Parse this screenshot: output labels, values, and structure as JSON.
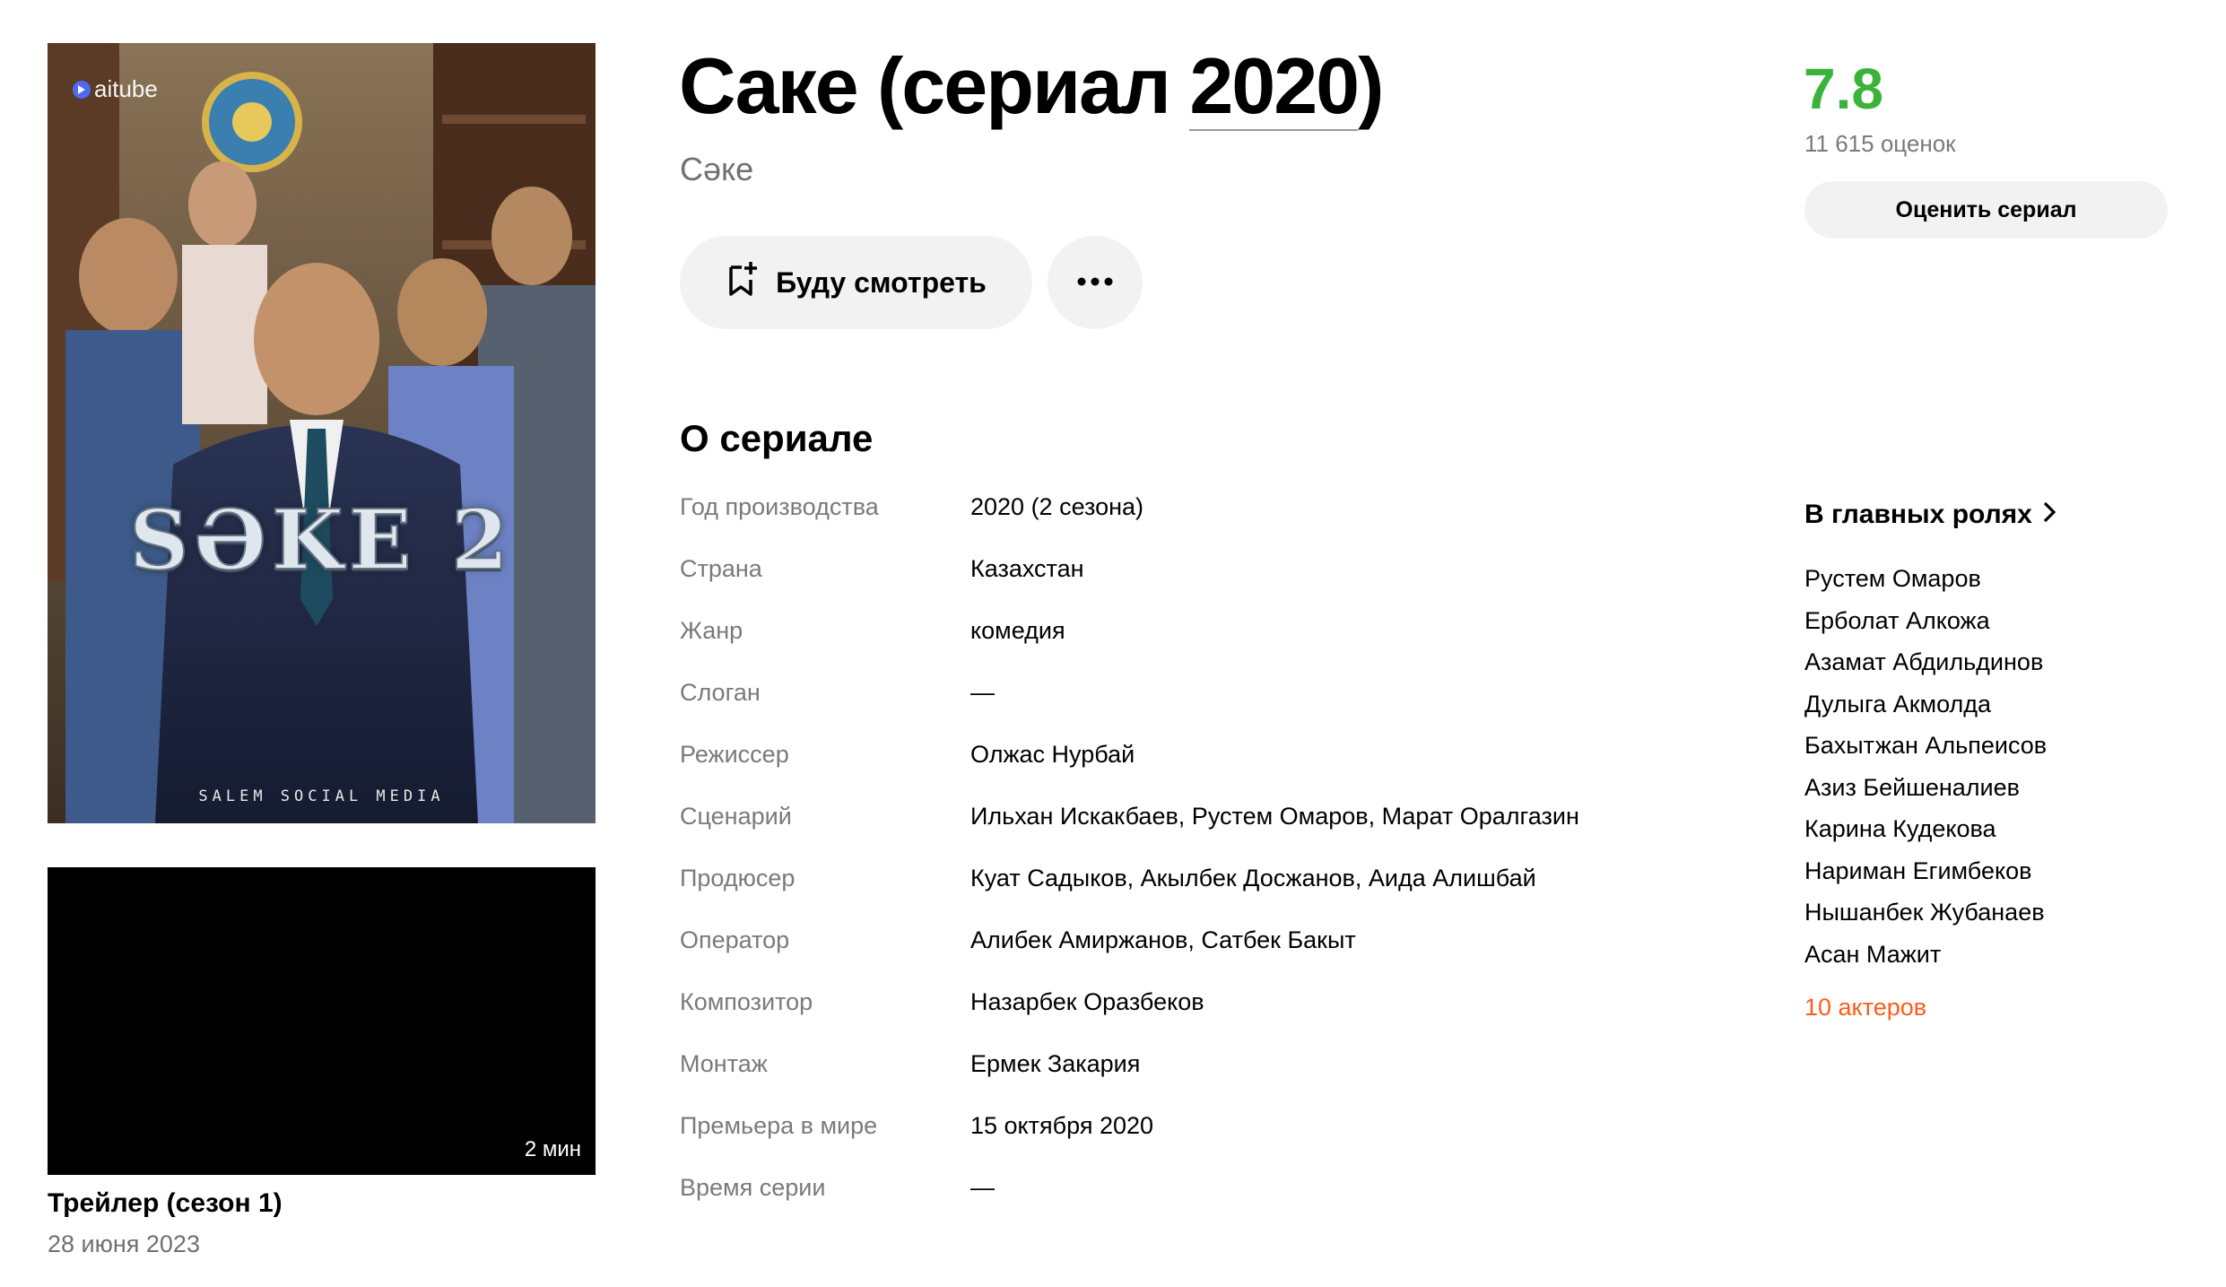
{
  "film": {
    "title_main": "Саке (сериал ",
    "title_year": "2020",
    "title_end": ")",
    "original_title": "Сәке"
  },
  "poster": {
    "brand": "aitube",
    "title_art": "SƏKE 2",
    "studio": "SALEM SOCIAL MEDIA"
  },
  "actions": {
    "watch_label": "Буду смотреть",
    "watch_icon": "bookmark-plus-icon",
    "more_icon": "more-dots-icon"
  },
  "rating": {
    "value": "7.8",
    "count": "11 615 оценок",
    "rate_button": "Оценить сериал",
    "color": "#3bb33b"
  },
  "about": {
    "title": "О сериале",
    "rows": [
      {
        "label": "Год производства",
        "value": "2020 (2 сезона)"
      },
      {
        "label": "Страна",
        "value": "Казахстан"
      },
      {
        "label": "Жанр",
        "value": "комедия"
      },
      {
        "label": "Слоган",
        "value": "—"
      },
      {
        "label": "Режиссер",
        "value": "Олжас Нурбай"
      },
      {
        "label": "Сценарий",
        "value": "Ильхан Искакбаев, Рустем Омаров, Марат Оралгазин"
      },
      {
        "label": "Продюсер",
        "value": "Куат Садыков, Акылбек Досжанов, Аида Алишбай"
      },
      {
        "label": "Оператор",
        "value": "Алибек Амиржанов, Сатбек Бакыт"
      },
      {
        "label": "Композитор",
        "value": "Назарбек Оразбеков"
      },
      {
        "label": "Монтаж",
        "value": "Ермек Закария"
      },
      {
        "label": "Премьера в мире",
        "value": "15 октября 2020"
      },
      {
        "label": "Время серии",
        "value": "—"
      }
    ]
  },
  "cast": {
    "title": "В главных ролях",
    "actors": [
      "Рустем Омаров",
      "Ерболат Алкожа",
      "Азамат Абдильдинов",
      "Дулыга Акмолда",
      "Бахытжан Альпеисов",
      "Азиз Бейшеналиев",
      "Карина Кудекова",
      "Нариман Егимбеков",
      "Нышанбек Жубанаев",
      "Асан Мажит"
    ],
    "more_link": "10 актеров",
    "more_color": "#ff5c1a"
  },
  "trailer": {
    "duration": "2 мин",
    "title": "Трейлер (сезон 1)",
    "date": "28 июня 2023"
  }
}
